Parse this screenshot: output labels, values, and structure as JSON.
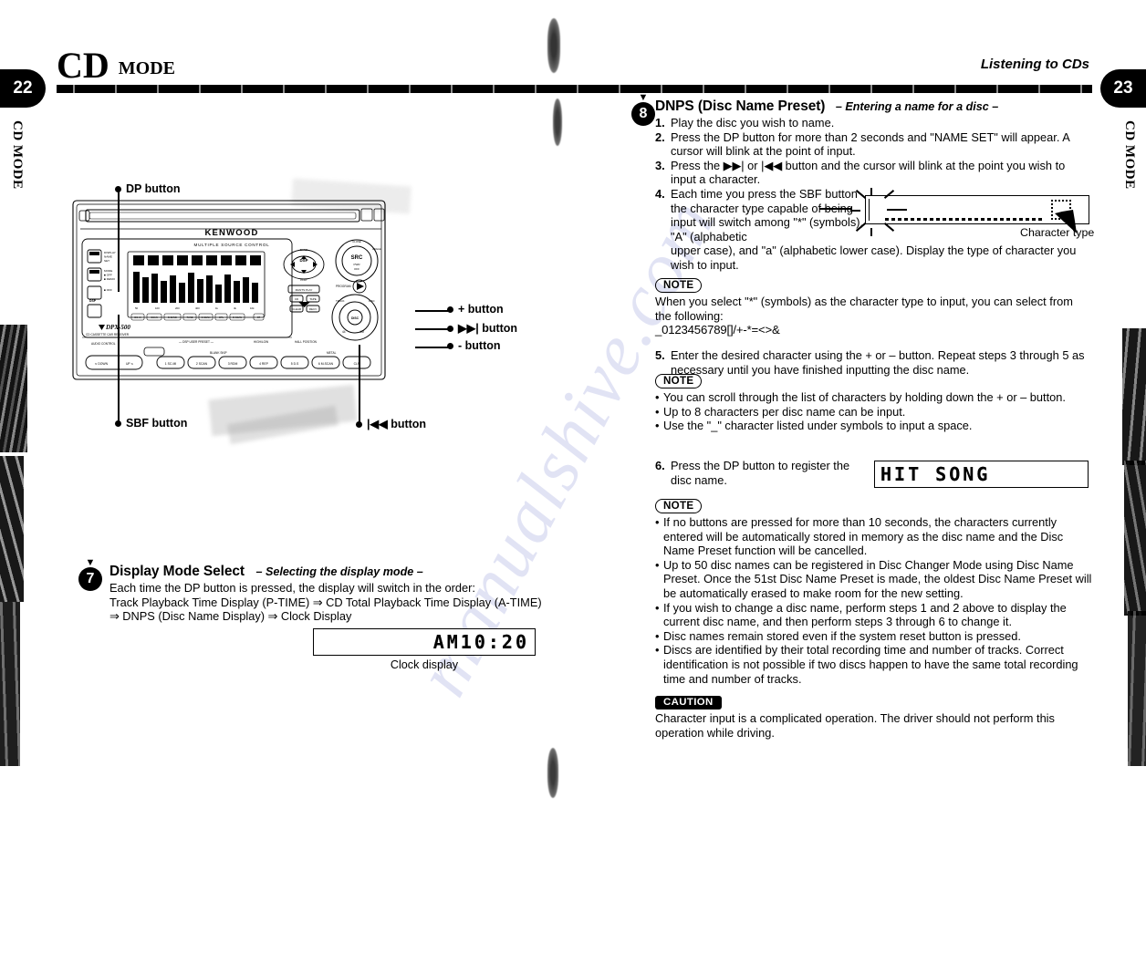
{
  "document": {
    "watermark_text": "manualshive.com"
  },
  "left_page": {
    "page_number": "22",
    "header_title": "CD",
    "header_subtitle": "MODE",
    "side_tab": "CD MODE",
    "diagram": {
      "brand": "KENWOOD",
      "model": "DPX-500",
      "model_sub": "CD CASSETTE CAR RECEIVER",
      "panel_label": "MULTIPLE SOURCE CONTROL",
      "callouts": [
        {
          "label": "DP button"
        },
        {
          "label": "SBF button"
        },
        {
          "label": "+ button"
        },
        {
          "label": "▶▶| button"
        },
        {
          "label": "- button"
        },
        {
          "label": "|◀◀ button"
        }
      ]
    },
    "section7": {
      "step_number": "7",
      "title": "Display Mode Select",
      "subtitle": "– Selecting the display mode –",
      "body_line1": "Each time the DP button is pressed, the display will switch in the order:",
      "body_line2": "Track Playback Time Display (P-TIME) ⇒ CD Total Playback Time Display (A-TIME)",
      "body_line3": "⇒ DNPS (Disc Name Display) ⇒ Clock Display",
      "lcd_value": "AM10:20",
      "lcd_caption": "Clock display"
    }
  },
  "right_page": {
    "page_number": "23",
    "header_title": "Listening to CDs",
    "side_tab": "CD MODE",
    "section8": {
      "step_number": "8",
      "title": "DNPS (Disc Name Preset)",
      "subtitle": "– Entering a name for a disc –",
      "steps": [
        {
          "num": "1.",
          "text": "Play the disc you wish to name."
        },
        {
          "num": "2.",
          "text": "Press the DP button for more than 2 seconds and \"NAME SET\" will appear. A cursor will blink at the point of input."
        },
        {
          "num": "3.",
          "text": "Press the ▶▶| or |◀◀ button and the cursor will blink at the point you wish to input a character."
        },
        {
          "num": "4.",
          "text": "Each time you press the SBF button the character type capable of being input will switch among \"*\" (symbols), \"A\" (alphabetic"
        },
        {
          "num": "5.",
          "text": "Enter the desired character using the + or – button. Repeat steps 3 through 5 as necessary until you have finished inputting the disc name."
        },
        {
          "num": "6.",
          "text": "Press the DP button to register the disc name."
        }
      ],
      "step4_tail": "upper case), and \"a\" (alphabetic lower case). Display the type of character you wish to input.",
      "diagram_label": "Character type",
      "note1": {
        "badge": "NOTE",
        "line1": "When you select \"*\" (symbols) as the character type to input, you can select from",
        "line2": "the following:",
        "symbols": "_0123456789[]/+-*=<>&"
      },
      "note2": {
        "badge": "NOTE",
        "bullets": [
          "You can scroll through the list of characters by holding down the + or – button.",
          "Up to 8 characters per disc name can be input.",
          "Use the \"_\" character listed under symbols to input a space."
        ]
      },
      "lcd_value": "HIT SONG",
      "note3": {
        "badge": "NOTE",
        "bullets": [
          "If no buttons are pressed for more than 10 seconds, the characters currently entered will be automatically stored in memory as the disc name and the Disc Name Preset function will be cancelled.",
          "Up to 50 disc names can be registered in Disc Changer Mode using Disc Name Preset. Once the 51st Disc Name Preset is made, the oldest Disc Name Preset will be automatically erased to make room for the new setting.",
          "If you wish to change a disc name, perform steps 1 and 2 above to display the current disc name, and then perform steps 3 through 6 to change it.",
          "Disc names remain stored even if the system reset button is pressed.",
          "Discs are identified by their total recording time and number of tracks. Correct identification is not possible if two discs happen to have the same total recording time and number of tracks."
        ]
      },
      "caution": {
        "badge": "CAUTION",
        "text": "Character input is a complicated operation. The driver should not perform this operation while driving."
      }
    }
  }
}
